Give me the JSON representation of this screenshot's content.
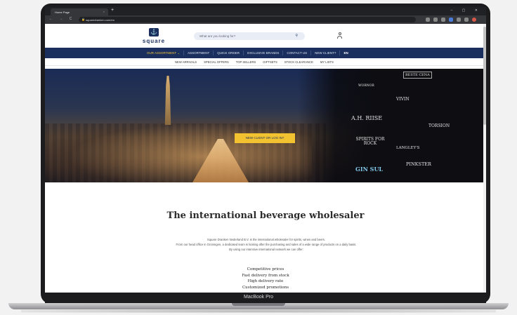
{
  "browser": {
    "tab_title": "Home Page",
    "tab_close": "×",
    "new_tab": "+",
    "window_controls": "– ▢ ✕",
    "nav_buttons": "← → C ⌂",
    "url": "squaredranken.com/en"
  },
  "header": {
    "logo_mark": "⚓",
    "logo_text": "square",
    "search_placeholder": "What are you looking for?"
  },
  "main_nav": {
    "items": [
      {
        "label": "OUR ASSORTMENT ⌄",
        "active": true
      },
      {
        "label": "ASSORTMENT"
      },
      {
        "label": "QUICK ORDER"
      },
      {
        "label": "EXCLUSIVE BRANDS"
      },
      {
        "label": "CONTACT US"
      },
      {
        "label": "NEW CLIENT?"
      }
    ],
    "language": "EN"
  },
  "sub_nav": {
    "items": [
      "NEW ARRIVALS",
      "SPECIAL OFFERS",
      "TOP SELLERS",
      "GIFTSETS",
      "STOCK CLEARANCE",
      "MY LISTS"
    ]
  },
  "hero": {
    "cta": "NEW CLIENT OR LOG IN?",
    "brands": [
      "BESTE CENA",
      "WORNOR",
      "VIVIN",
      "A.H. RIISE",
      "TORSION",
      "SPIRITS FOR ROCK",
      "LANGLEY'S",
      "GIN SUL",
      "PINKSTER"
    ]
  },
  "content": {
    "headline": "The international beverage wholesaler",
    "intro": [
      "Square Dranken Nederland B.V. is the international wholesaler for spirits, wines and beers.",
      "From our head office in Groningen, a dedicated team is looking after the purchasing and sales of a wide range of products on a daily basis.",
      "By using our intensive international network we can offer:"
    ],
    "benefits": [
      "Competitive prices",
      "Fast delivery from stock",
      "High delivery rate",
      "Customized promotions"
    ]
  },
  "device": {
    "label": "MacBook Pro"
  }
}
